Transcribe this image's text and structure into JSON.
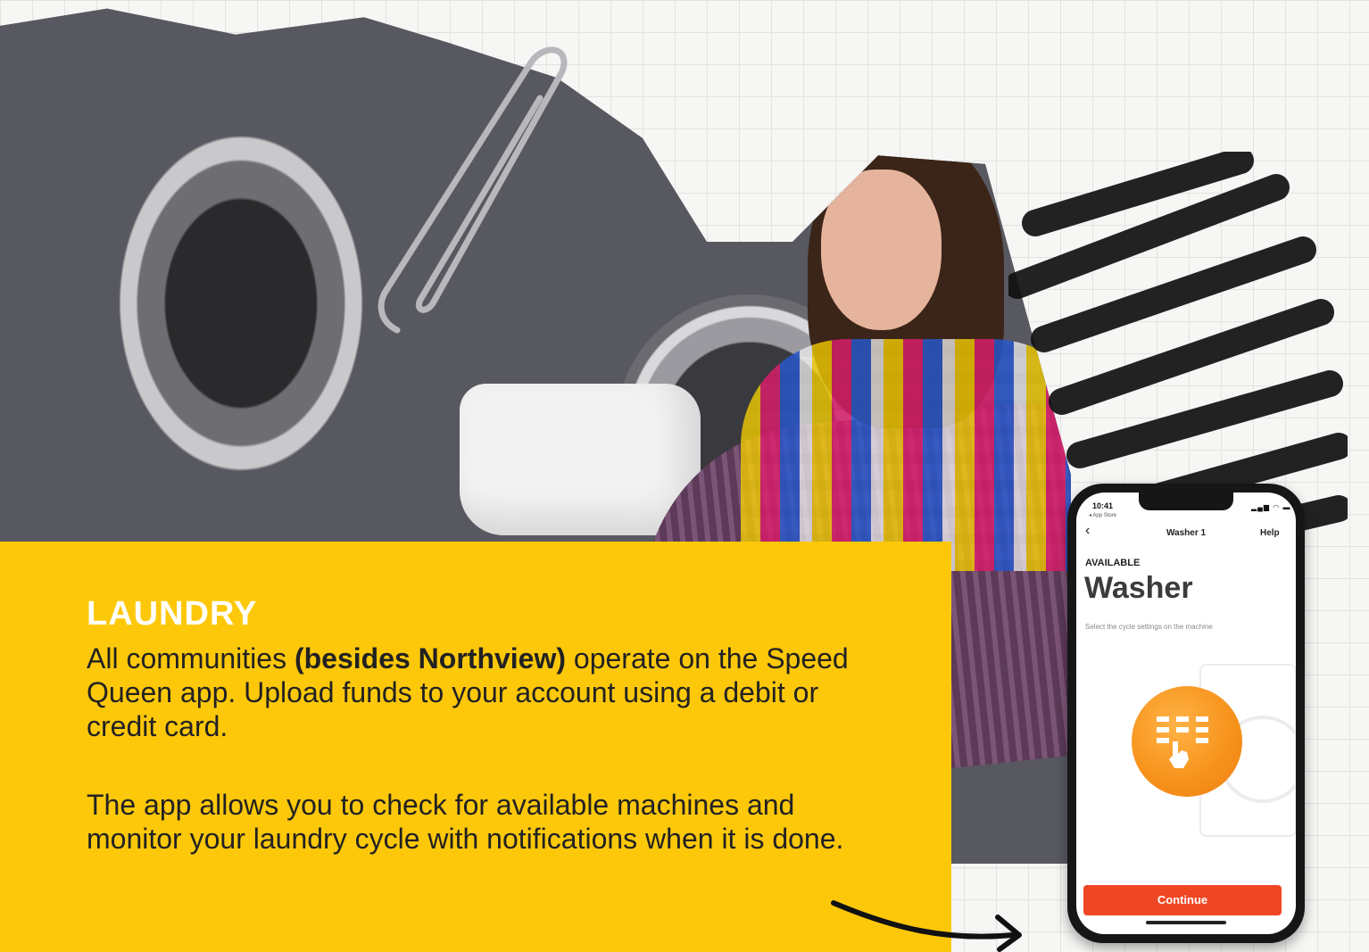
{
  "card": {
    "title": "LAUNDRY",
    "para1_before": "All communities ",
    "para1_bold": "(besides Northview)",
    "para1_after": " operate on the Speed Queen app. Upload funds to your account using a debit or credit card.",
    "para2": "The app allows you to check for available machines and monitor your laundry cycle with notifications when it is done."
  },
  "phone": {
    "time": "10:41",
    "back_app": "◂ App Store",
    "nav_title": "Washer 1",
    "help": "Help",
    "status_label": "AVAILABLE",
    "machine_name": "Washer",
    "instruction": "Select the cycle settings on the machine",
    "continue_label": "Continue"
  },
  "colors": {
    "card": "#fec80a",
    "title": "#ffffff",
    "button": "#ef4623",
    "orb": "#f7941d"
  },
  "icons": [
    "paperclip-icon",
    "arrow-icon",
    "back-chevron-icon",
    "keypad-touch-icon",
    "signal-icon",
    "wifi-icon",
    "battery-icon"
  ]
}
